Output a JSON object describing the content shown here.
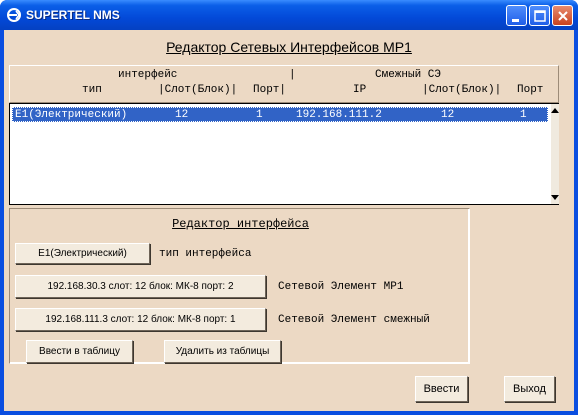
{
  "window": {
    "title": "SUPERTEL NMS",
    "icon": "supertel-logo-icon"
  },
  "main": {
    "title": "Редактор Сетевых Интерфейсов МР1"
  },
  "table": {
    "header_top_left": "интерфейс",
    "header_sep": "|",
    "header_top_right": "Смежный СЭ",
    "columns": [
      "тип",
      "|Слот(Блок)|",
      "Порт|",
      "IP",
      "|Слот(Блок)|",
      "Порт"
    ],
    "rows": [
      {
        "type": "E1(Электрический)",
        "slot": "12",
        "port": "1",
        "ip": "192.168.111.2",
        "peer_slot": "12",
        "peer_port": "1"
      }
    ]
  },
  "editor": {
    "title": "Редактор интерфейса",
    "type_button": "E1(Электрический)",
    "type_label": "тип интерфейса",
    "ne_mp1_button": "192.168.30.3 слот: 12 блок: МК-8 порт: 2",
    "ne_mp1_label": "Сетевой Элемент МР1",
    "ne_peer_button": "192.168.111.3 слот: 12 блок: МК-8 порт: 1",
    "ne_peer_label": "Сетевой Элемент смежный",
    "add_button": "Ввести в таблицу",
    "delete_button": "Удалить из таблицы"
  },
  "footer": {
    "enter_button": "Ввести",
    "exit_button": "Выход"
  }
}
